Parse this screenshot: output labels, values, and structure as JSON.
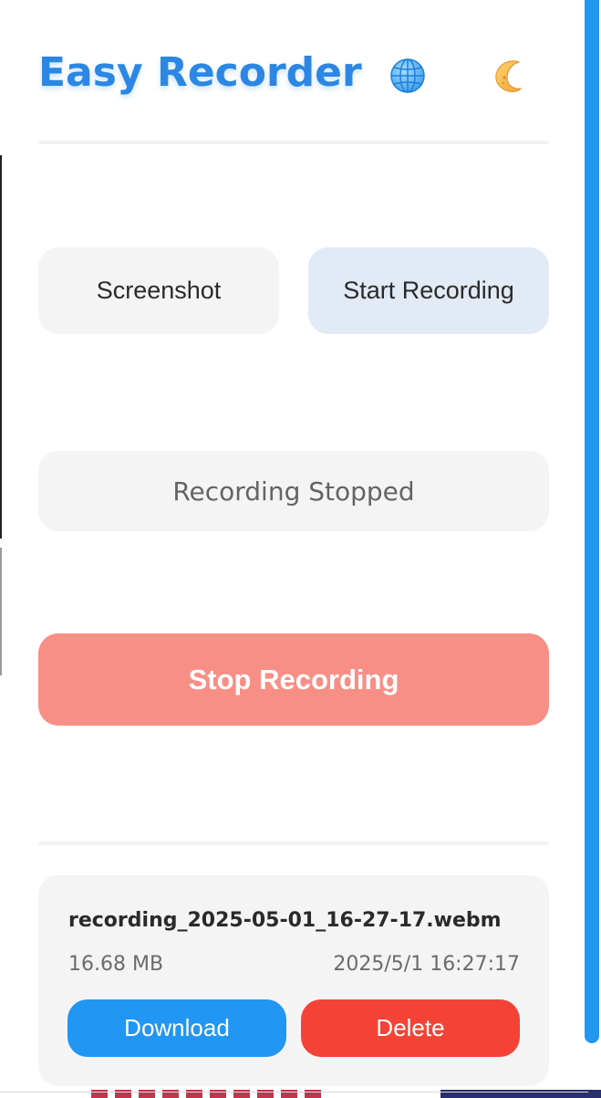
{
  "header": {
    "title": "Easy Recorder",
    "language_icon": "globe-icon",
    "theme_icon": "moon-icon"
  },
  "modes": {
    "screenshot_label": "Screenshot",
    "record_label": "Start Recording"
  },
  "status": {
    "text": "Recording Stopped"
  },
  "actions": {
    "stop_label": "Stop Recording"
  },
  "recordings": [
    {
      "filename": "recording_2025-05-01_16-27-17.webm",
      "size": "16.68 MB",
      "timestamp": "2025/5/1 16:27:17",
      "download_label": "Download",
      "delete_label": "Delete"
    }
  ],
  "colors": {
    "accent": "#2b87e3",
    "scrollbar": "#2196f3",
    "stop": "#f88f86",
    "download": "#2196f3",
    "delete": "#f44336"
  }
}
